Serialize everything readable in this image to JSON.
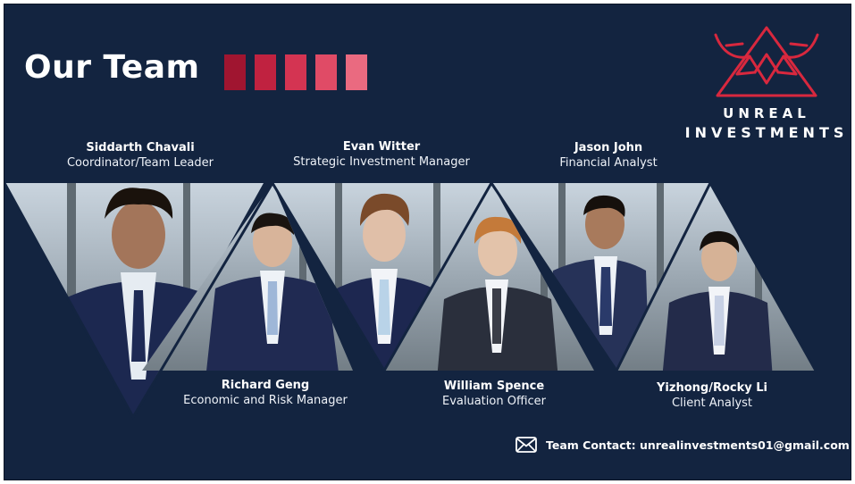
{
  "slide": {
    "title": "Our Team",
    "accent_colors": [
      "#a01530",
      "#c02240",
      "#d43452",
      "#e04b66",
      "#ea6a80"
    ],
    "background_color": "#132440"
  },
  "logo": {
    "line1": "UNREAL",
    "line2": "INVESTMENTS",
    "color": "#d8283e",
    "icon": "bull-triangle-logo"
  },
  "team": [
    {
      "name": "Siddarth Chavali",
      "role": "Coordinator/Team Leader"
    },
    {
      "name": "Evan Witter",
      "role": "Strategic Investment Manager"
    },
    {
      "name": "Jason John",
      "role": "Financial Analyst"
    },
    {
      "name": "Richard Geng",
      "role": "Economic and Risk Manager"
    },
    {
      "name": "William Spence",
      "role": "Evaluation Officer"
    },
    {
      "name": "Yizhong/Rocky Li",
      "role": "Client Analyst"
    }
  ],
  "contact": {
    "label": "Team Contact: unrealinvestments01@gmail.com",
    "icon": "mail-icon"
  }
}
